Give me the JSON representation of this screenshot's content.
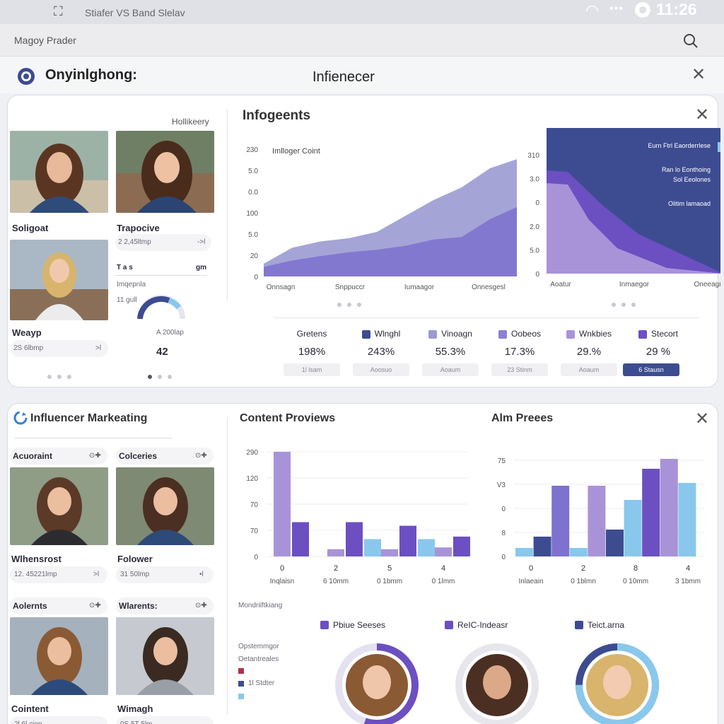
{
  "statusbar": {
    "app_label": "Stiafer VS   Band Slelav",
    "time": "11:26"
  },
  "urlbar": {
    "text": "Magoy Prader"
  },
  "header": {
    "brand": "Onyinlghong:",
    "title": "Infienecer"
  },
  "top_card": {
    "profile_label": "Hollikeery",
    "profiles": [
      {
        "name": "Soligoat"
      },
      {
        "name": "Trapocive",
        "stat": "2 2,45ltmp",
        "arrow": "->l"
      },
      {
        "name": "Weayp",
        "stat": "2S 6lbmp",
        "arrow": ">l"
      }
    ],
    "mini": {
      "label1": "T   a   s",
      "label1b": "gm",
      "label2": "Imqepnla",
      "label3": "11 gull",
      "stat": "A 200lap",
      "value": "42"
    },
    "title": "Infogeents",
    "chart1_label": "Imlloger Coint",
    "chart2_legend": [
      "Eurn   Ftrl Eaorderrlese",
      "Ran lo Eonthoing",
      "Sol Eeolones",
      "Olitim lamaoad"
    ],
    "stats": [
      {
        "label": "Gretens",
        "value": "198%",
        "btn": "1l lsam",
        "color": ""
      },
      {
        "label": "Wlnghl",
        "value": "243%",
        "btn": "Aoosuo",
        "color": "#3d4c91"
      },
      {
        "label": "Vinoagn",
        "value": "55.3%",
        "btn": "Aoaum",
        "color": "#9b9ad0"
      },
      {
        "label": "Oobeos",
        "value": "17.3%",
        "btn": "23 Stinm",
        "color": "#8d7fd4"
      },
      {
        "label": "Wnkbies",
        "value": "29.%",
        "btn": "Aoaum",
        "color": "#a993d8"
      },
      {
        "label": "Stecort",
        "value": "29 %",
        "btn": "6 Stausn",
        "color": "#6c4fc1"
      }
    ]
  },
  "bottom_card": {
    "brand": "Influencer Markeating",
    "profiles": [
      {
        "header": "Acuoraint",
        "name": "Wlhensrost",
        "stat": "12. 45221lmp",
        "arrow": ">l"
      },
      {
        "header": "Colceries",
        "name": "Folower",
        "stat": "31 50lmp",
        "arrow": "•l"
      },
      {
        "header": "Aolernts",
        "name": "Cointent",
        "stat": "2l 6l.ciop",
        "arrow": ""
      },
      {
        "header": "Wlarents:",
        "name": "Wimagh",
        "stat": "0S 5T 5lm",
        "arrow": ""
      }
    ],
    "content_title": "Content Proviews",
    "alm_title": "Alm Preees",
    "marketing_label": "Mondriiftkiang",
    "legend": [
      "Pbiue Seeses",
      "ReIC-Indeasr",
      "Teict.arna"
    ],
    "side_labels": [
      "Opstemmgor",
      "Oetantreales",
      "",
      "1l Stdter"
    ]
  },
  "chart_data": [
    {
      "type": "area",
      "title": "Imlloger Coint",
      "categories": [
        "Onnsagn",
        "Snppuccr",
        "Iumaagor",
        "Onnesgesl"
      ],
      "yticks": [
        "0",
        "20",
        "5.0",
        "100",
        "0.0",
        "5.0",
        "230"
      ],
      "series": [
        {
          "values": [
            20,
            45,
            55,
            60,
            70,
            95,
            120,
            140,
            170,
            185
          ]
        },
        {
          "values": [
            15,
            25,
            32,
            38,
            42,
            48,
            58,
            62,
            90,
            110
          ]
        }
      ],
      "colors": [
        "#9b9ad3",
        "#7f73cf"
      ]
    },
    {
      "type": "area",
      "categories": [
        "Aoatur",
        "Inmaegor",
        "Oneeagr"
      ],
      "yticks": [
        "0",
        "5.0",
        "2.0",
        "0",
        "3.0",
        "310"
      ],
      "colors": [
        "#3d4c91",
        "#6c4fc1",
        "#a993d8"
      ]
    },
    {
      "type": "bar",
      "title": "Content Proviews",
      "categories": [
        "0",
        "2",
        "5",
        "4"
      ],
      "sublabels": [
        "Inqlaisn",
        "6 10mm",
        "0 1bmm",
        "0 1lmm"
      ],
      "yticks": [
        "0",
        "70",
        "70",
        "120",
        "290"
      ],
      "ylim": [
        0,
        290
      ],
      "series": [
        {
          "values": [
            290,
            20,
            20,
            25
          ]
        },
        {
          "values": [
            95,
            95,
            85,
            55
          ]
        },
        {
          "values": [
            0,
            48,
            48,
            0
          ]
        },
        {
          "values": [
            0,
            0,
            0,
            205
          ]
        }
      ],
      "colors": [
        "#a993d8",
        "#6c4fc1",
        "#89c8ec",
        "#6c4fc1"
      ]
    },
    {
      "type": "bar",
      "title": "Alm Preees",
      "categories": [
        "0",
        "2",
        "8",
        "4"
      ],
      "sublabels": [
        "Inlaeain",
        "0 1blmn",
        "0 10mm",
        "3 1bmm"
      ],
      "yticks": [
        "0",
        "8",
        "0",
        "V3",
        "75"
      ],
      "ylim": [
        0,
        75
      ]
    }
  ],
  "rings": [
    {
      "pct": 0.55,
      "color": "#6c4fc1",
      "track": "#e4e2f0"
    },
    {
      "pct": 0.0,
      "color": "#c9c9d6",
      "track": "#e6e6ec"
    },
    {
      "pct": 0.75,
      "color": "#89c8ec",
      "track": "#3d4c91"
    }
  ]
}
